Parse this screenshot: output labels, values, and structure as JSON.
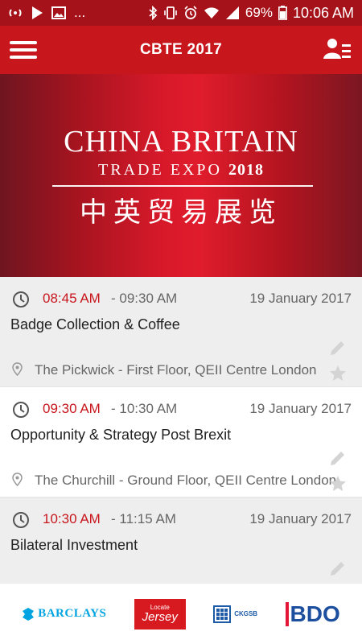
{
  "status_bar": {
    "battery": "69%",
    "time": "10:06 AM",
    "ellipsis": "...",
    "icons": [
      "hotspot-icon",
      "play-store-icon",
      "image-icon",
      "bluetooth-icon",
      "vibrate-icon",
      "alarm-icon",
      "wifi-icon",
      "signal-icon",
      "battery-icon"
    ]
  },
  "app_bar": {
    "title": "CBTE 2017",
    "icons": [
      "hamburger-menu-icon",
      "profile-list-icon"
    ]
  },
  "banner": {
    "line1": "CHINA BRITAIN",
    "line2_text": "TRADE EXPO",
    "line2_year": "2018",
    "chinese": "中英贸易展览"
  },
  "sessions": [
    {
      "start": "08:45 AM",
      "end": "- 09:30 AM",
      "date": "19 January 2017",
      "title": "Badge Collection & Coffee",
      "location": "The Pickwick - First Floor, QEII Centre London"
    },
    {
      "start": "09:30 AM",
      "end": "- 10:30 AM",
      "date": "19 January 2017",
      "title": "Opportunity & Strategy Post Brexit",
      "location": "The Churchill - Ground Floor, QEII Centre London"
    },
    {
      "start": "10:30 AM",
      "end": "- 11:15 AM",
      "date": "19 January 2017",
      "title": "Bilateral Investment",
      "location": ""
    }
  ],
  "sponsors": {
    "barclays": "BARCLAYS",
    "jersey_small": "Locate",
    "jersey_large": "Jersey",
    "ckgsb": "CKGSB",
    "bdo": "BDO"
  },
  "colors": {
    "primary": "#c8161d",
    "status_bar": "#a6121a",
    "start_time": "#c8161d",
    "row_shade": "#eeeeee"
  }
}
